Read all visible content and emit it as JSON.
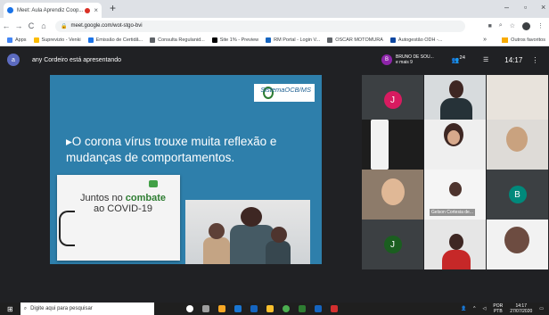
{
  "browser": {
    "tab_title": "Meet: Aula Aprendiz Coop...",
    "tab_close": "×",
    "new_tab": "+",
    "window_controls": [
      "–",
      "▫",
      "×"
    ],
    "url": "meet.google.com/wot-stgo-bvi",
    "bookmarks": [
      "Apps",
      "Suprevizio - Venki",
      "Emissão de Certidã...",
      "Consulta Regulanid...",
      "Site 1% - Preview",
      "RM Portal - Login V...",
      "OSCAR MOTOMURA",
      "Autogestão ODH -..."
    ],
    "bookmarks_more": "»",
    "other_bookmarks": "Outros favoritos"
  },
  "meet": {
    "presenter_initial": "a",
    "presenting_text": "any Cordeiro está apresentando",
    "header_avatar": "B",
    "header_name_1": "BRUNO DE SOU...",
    "header_name_2": "e mais 9",
    "participants_badge": "24",
    "time": "14:17",
    "slide": {
      "logo": "SistemaOCB/MS",
      "bullet": "O corona vírus trouxe muita reflexão e mudanças de comportamentos.",
      "covid_line1": "Juntos no ",
      "covid_bold": "combate",
      "covid_line2": "ao COVID-19"
    },
    "tiles": [
      {
        "type": "avatar",
        "initial": "J",
        "color": "#d81b60"
      },
      {
        "type": "video",
        "label": ""
      },
      {
        "type": "video",
        "label": ""
      },
      {
        "type": "video",
        "label": ""
      },
      {
        "type": "video",
        "label": ""
      },
      {
        "type": "video",
        "label": "Gelson Cortesia de..."
      },
      {
        "type": "avatar",
        "initial": "B",
        "color": "#00897b"
      },
      {
        "type": "avatar",
        "initial": "J",
        "color": "#1b5e20"
      },
      {
        "type": "video",
        "label": ""
      },
      {
        "type": "video",
        "label": ""
      }
    ]
  },
  "taskbar": {
    "search_placeholder": "Digite aqui para pesquisar",
    "lang": "POR",
    "lang2": "PTB",
    "clock_time": "14:17",
    "clock_date": "27/07/2020"
  }
}
